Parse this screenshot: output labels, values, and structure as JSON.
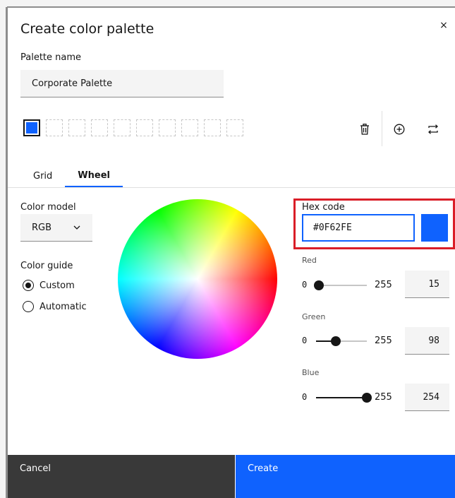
{
  "dialog": {
    "title": "Create color palette",
    "close_glyph": "×"
  },
  "palette_name": {
    "label": "Palette name",
    "value": "Corporate Palette"
  },
  "swatches": {
    "selected_color": "#0F62FE",
    "empty_count": 9
  },
  "toolbar": {
    "icons": [
      "trash-icon",
      "add-circle-icon",
      "swap-icon"
    ]
  },
  "tabs": [
    {
      "label": "Grid",
      "active": false
    },
    {
      "label": "Wheel",
      "active": true
    }
  ],
  "color_model": {
    "label": "Color model",
    "value": "RGB"
  },
  "color_guide": {
    "label": "Color guide",
    "options": [
      {
        "label": "Custom",
        "selected": true
      },
      {
        "label": "Automatic",
        "selected": false
      }
    ]
  },
  "hex": {
    "label": "Hex code",
    "value": "#0F62FE"
  },
  "channels": [
    {
      "label": "Red",
      "min": "0",
      "max": "255",
      "value": "15"
    },
    {
      "label": "Green",
      "min": "0",
      "max": "255",
      "value": "98"
    },
    {
      "label": "Blue",
      "min": "0",
      "max": "255",
      "value": "254"
    }
  ],
  "footer": {
    "cancel_label": "Cancel",
    "create_label": "Create"
  },
  "colors": {
    "primary": "#0f62fe",
    "highlight": "#da1e28",
    "footer_secondary": "#393939"
  }
}
